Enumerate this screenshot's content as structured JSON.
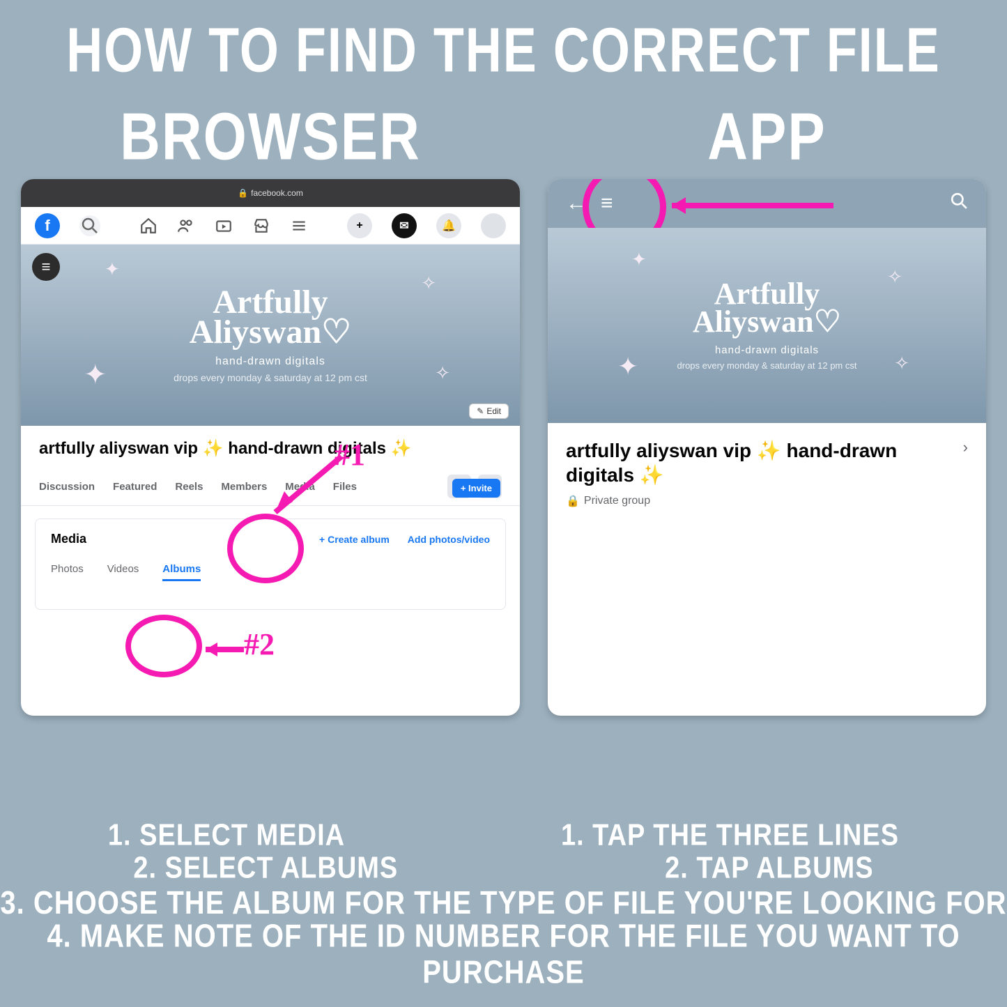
{
  "title": "HOW TO FIND THE CORRECT FILE",
  "browser_label": "BROWSER",
  "app_label": "APP",
  "browser": {
    "url": "facebook.com",
    "cover": {
      "script1": "Artfully",
      "script2": "Aliyswan♡",
      "sub": "hand-drawn digitals",
      "sub2": "drops every monday & saturday at 12 pm cst"
    },
    "edit_label": "Edit",
    "group_name": "artfully aliyswan vip ✨ hand-drawn digitals ✨",
    "invite_label": "+ Invite",
    "tabs": [
      "Discussion",
      "Featured",
      "Reels",
      "Members",
      "Media",
      "Files"
    ],
    "media_heading": "Media",
    "media_actions": {
      "create": "+  Create album",
      "add": "Add photos/video"
    },
    "subtabs": [
      "Photos",
      "Videos",
      "Albums"
    ]
  },
  "app": {
    "cover": {
      "script1": "Artfully",
      "script2": "Aliyswan♡",
      "sub": "hand-drawn digitals",
      "sub2": "drops every monday & saturday at 12 pm cst"
    },
    "group_name": "artfully aliyswan vip ✨ hand-drawn digitals ✨",
    "private_label": "Private group"
  },
  "annotations": {
    "n1": "#1",
    "n2": "#2"
  },
  "instructions": {
    "browser1": "1. SELECT MEDIA",
    "browser2": "2. SELECT ALBUMS",
    "app1": "1. TAP THE THREE LINES",
    "app2": "2. TAP ALBUMS",
    "full3": "3. CHOOSE THE ALBUM FOR THE TYPE OF FILE YOU'RE LOOKING FOR",
    "full4": "4. MAKE NOTE OF THE ID NUMBER FOR THE FILE YOU WANT TO PURCHASE"
  }
}
